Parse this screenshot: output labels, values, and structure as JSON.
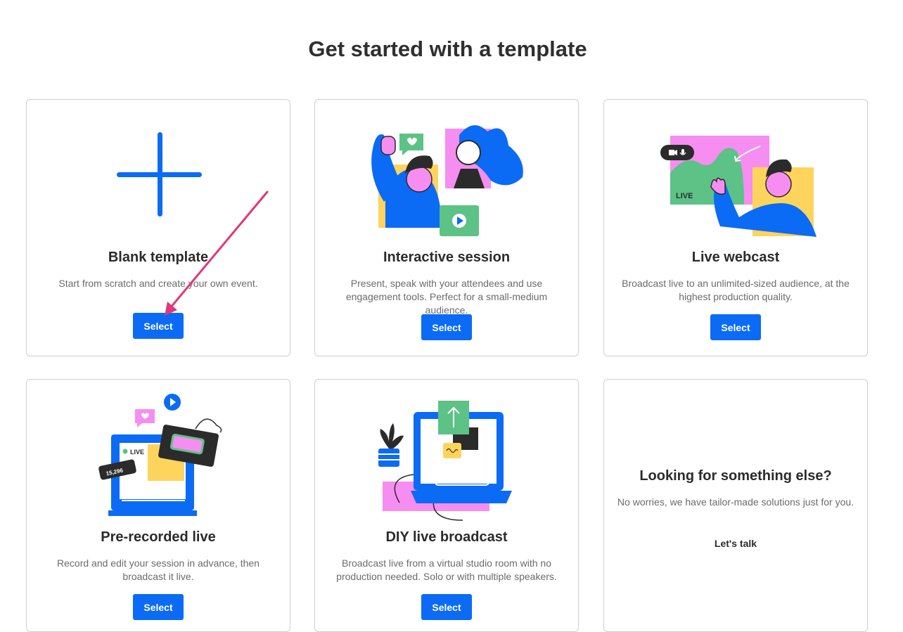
{
  "page": {
    "title": "Get started with a template"
  },
  "cards": [
    {
      "title": "Blank template",
      "description": "Start from scratch and create your own event.",
      "button": "Select",
      "icon": "plus-icon"
    },
    {
      "title": "Interactive session",
      "description": "Present, speak with your attendees and use engagement tools. Perfect for a small-medium audience.",
      "button": "Select",
      "icon": "interactive-session-illustration"
    },
    {
      "title": "Live webcast",
      "description": "Broadcast live to an unlimited-sized audience, at the highest production quality.",
      "button": "Select",
      "icon": "live-webcast-illustration",
      "badge": "LIVE"
    },
    {
      "title": "Pre-recorded live",
      "description": "Record and edit your session in advance, then broadcast it live.",
      "button": "Select",
      "icon": "pre-recorded-illustration",
      "badge": "LIVE",
      "viewers": "15,296"
    },
    {
      "title": "DIY live broadcast",
      "description": "Broadcast live from a virtual studio room with no production needed. Solo or with multiple speakers.",
      "button": "Select",
      "icon": "diy-broadcast-illustration"
    },
    {
      "title": "Looking for something else?",
      "description": "No worries, we have tailor-made solutions just for you.",
      "link": "Let's talk"
    }
  ],
  "colors": {
    "accent": "#0b6bf5",
    "pink": "#f58ef0",
    "yellow": "#ffd45c",
    "green": "#5cc285",
    "annotation": "#e0387a"
  }
}
